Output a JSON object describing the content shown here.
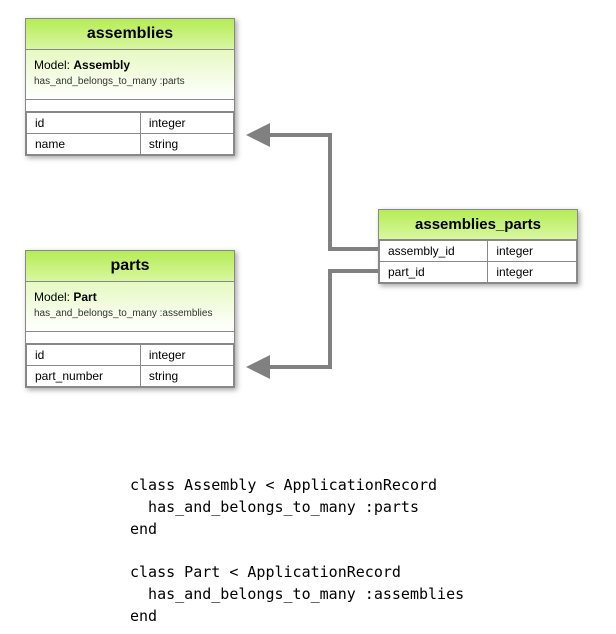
{
  "tables": {
    "assemblies": {
      "title": "assemblies",
      "model_prefix": "Model: ",
      "model_name": "Assembly",
      "assoc": "has_and_belongs_to_many :parts",
      "columns": [
        {
          "name": "id",
          "type": "integer"
        },
        {
          "name": "name",
          "type": "string"
        }
      ]
    },
    "parts": {
      "title": "parts",
      "model_prefix": "Model: ",
      "model_name": "Part",
      "assoc": "has_and_belongs_to_many :assemblies",
      "columns": [
        {
          "name": "id",
          "type": "integer"
        },
        {
          "name": "part_number",
          "type": "string"
        }
      ]
    },
    "join": {
      "title": "assemblies_parts",
      "columns": [
        {
          "name": "assembly_id",
          "type": "integer"
        },
        {
          "name": "part_id",
          "type": "integer"
        }
      ]
    }
  },
  "code": "class Assembly < ApplicationRecord\n  has_and_belongs_to_many :parts\nend\n\nclass Part < ApplicationRecord\n  has_and_belongs_to_many :assemblies\nend",
  "colors": {
    "header_gradient_top": "#b5ec55",
    "header_gradient_bottom": "#d9f7a1",
    "arrow": "#808080"
  }
}
